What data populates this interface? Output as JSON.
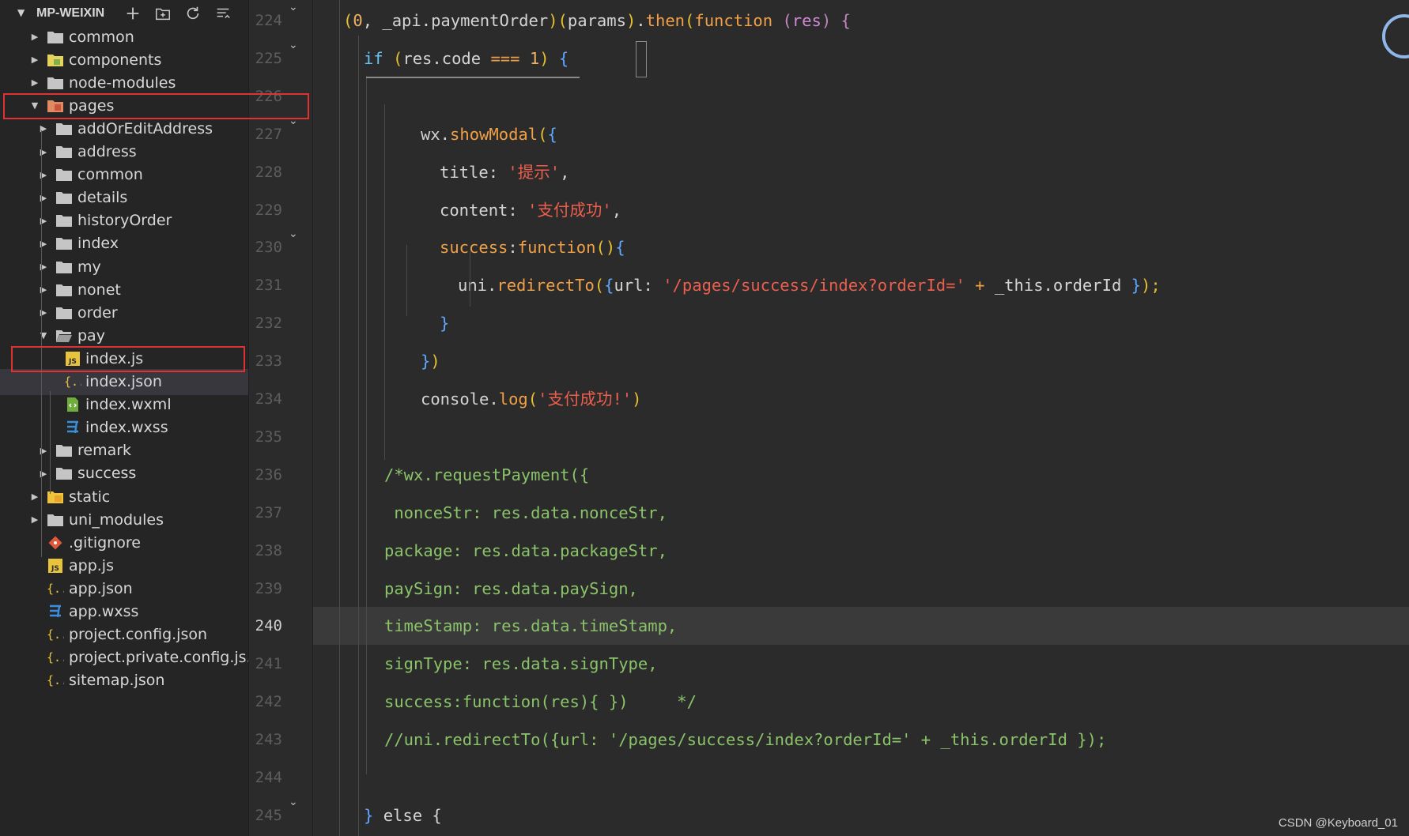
{
  "explorer": {
    "title": "MP-WEIXIN",
    "actions": [
      "new-file-icon",
      "new-folder-icon",
      "refresh-icon",
      "collapse-all-icon"
    ],
    "items": [
      {
        "label": "common",
        "kind": "folder",
        "state": "collapsed",
        "depth": 0
      },
      {
        "label": "components",
        "kind": "folder-components",
        "state": "collapsed",
        "depth": 0
      },
      {
        "label": "node-modules",
        "kind": "folder",
        "state": "collapsed",
        "depth": 0
      },
      {
        "label": "pages",
        "kind": "folder-pages",
        "state": "expanded",
        "depth": 0,
        "highlighted": true
      },
      {
        "label": "addOrEditAddress",
        "kind": "folder",
        "state": "collapsed",
        "depth": 1
      },
      {
        "label": "address",
        "kind": "folder",
        "state": "collapsed",
        "depth": 1
      },
      {
        "label": "common",
        "kind": "folder",
        "state": "collapsed",
        "depth": 1
      },
      {
        "label": "details",
        "kind": "folder",
        "state": "collapsed",
        "depth": 1
      },
      {
        "label": "historyOrder",
        "kind": "folder",
        "state": "collapsed",
        "depth": 1
      },
      {
        "label": "index",
        "kind": "folder",
        "state": "collapsed",
        "depth": 1
      },
      {
        "label": "my",
        "kind": "folder",
        "state": "collapsed",
        "depth": 1
      },
      {
        "label": "nonet",
        "kind": "folder",
        "state": "collapsed",
        "depth": 1
      },
      {
        "label": "order",
        "kind": "folder",
        "state": "collapsed",
        "depth": 1
      },
      {
        "label": "pay",
        "kind": "folder-open",
        "state": "expanded",
        "depth": 1
      },
      {
        "label": "index.js",
        "kind": "js",
        "depth": 2,
        "highlighted": true
      },
      {
        "label": "index.json",
        "kind": "json",
        "depth": 2,
        "selected": true
      },
      {
        "label": "index.wxml",
        "kind": "wxml",
        "depth": 2
      },
      {
        "label": "index.wxss",
        "kind": "css",
        "depth": 2
      },
      {
        "label": "remark",
        "kind": "folder",
        "state": "collapsed",
        "depth": 1
      },
      {
        "label": "success",
        "kind": "folder",
        "state": "collapsed",
        "depth": 1
      },
      {
        "label": "static",
        "kind": "folder-static",
        "state": "collapsed",
        "depth": 0
      },
      {
        "label": "uni_modules",
        "kind": "folder",
        "state": "collapsed",
        "depth": 0
      },
      {
        "label": ".gitignore",
        "kind": "git",
        "depth": 0
      },
      {
        "label": "app.js",
        "kind": "js",
        "depth": 0
      },
      {
        "label": "app.json",
        "kind": "json",
        "depth": 0
      },
      {
        "label": "app.wxss",
        "kind": "css",
        "depth": 0
      },
      {
        "label": "project.config.json",
        "kind": "json",
        "depth": 0
      },
      {
        "label": "project.private.config.js...",
        "kind": "json",
        "depth": 0
      },
      {
        "label": "sitemap.json",
        "kind": "json",
        "depth": 0
      }
    ]
  },
  "editor": {
    "active_line": "240",
    "line_numbers": [
      "224",
      "225",
      "226",
      "227",
      "228",
      "229",
      "230",
      "231",
      "232",
      "233",
      "234",
      "235",
      "236",
      "237",
      "238",
      "239",
      "240",
      "241",
      "242",
      "243",
      "244",
      "245"
    ],
    "fold_lines": [
      "224",
      "225",
      "227",
      "230",
      "245"
    ],
    "lines": [
      {
        "indent": 0,
        "tokens": [
          [
            "(",
            "t-paren"
          ],
          [
            "0",
            "t-num"
          ],
          [
            ", _api.",
            "t-default"
          ],
          [
            "paymentOrder",
            "t-default"
          ],
          [
            ")(",
            "t-paren"
          ],
          [
            "params",
            "t-default"
          ],
          [
            ")",
            "t-paren"
          ],
          [
            ".",
            "t-default"
          ],
          [
            "then",
            "t-func"
          ],
          [
            "(",
            "t-paren"
          ],
          [
            "function",
            "t-func"
          ],
          [
            " (",
            "t-brace"
          ],
          [
            "res",
            "t-param"
          ],
          [
            ") {",
            "t-brace"
          ]
        ]
      },
      {
        "indent": 1,
        "tokens": [
          [
            "if ",
            "t-keyword"
          ],
          [
            "(",
            "t-paren"
          ],
          [
            "res.code ",
            "t-default"
          ],
          [
            "=== ",
            "t-func"
          ],
          [
            "1",
            "t-num"
          ],
          [
            ") ",
            "t-paren"
          ],
          [
            "{",
            "t-blue"
          ]
        ]
      },
      {
        "indent": 0,
        "tokens": []
      },
      {
        "indent": 4,
        "tokens": [
          [
            "wx.",
            "t-default"
          ],
          [
            "showModal",
            "t-func"
          ],
          [
            "(",
            "t-paren"
          ],
          [
            "{",
            "t-blue"
          ]
        ]
      },
      {
        "indent": 5,
        "tokens": [
          [
            "title: ",
            "t-default"
          ],
          [
            "'提示'",
            "t-string"
          ],
          [
            ",",
            "t-default"
          ]
        ]
      },
      {
        "indent": 5,
        "tokens": [
          [
            "content: ",
            "t-default"
          ],
          [
            "'支付成功'",
            "t-string"
          ],
          [
            ",",
            "t-default"
          ]
        ]
      },
      {
        "indent": 5,
        "tokens": [
          [
            "success",
            "t-func"
          ],
          [
            ":",
            "t-default"
          ],
          [
            "function",
            "t-func"
          ],
          [
            "()",
            "t-paren"
          ],
          [
            "{",
            "t-blue"
          ]
        ]
      },
      {
        "indent": 6,
        "tokens": [
          [
            "uni.",
            "t-default"
          ],
          [
            "redirectTo",
            "t-func"
          ],
          [
            "(",
            "t-paren"
          ],
          [
            "{",
            "t-blue"
          ],
          [
            "url: ",
            "t-default"
          ],
          [
            "'/pages/success/index?orderId='",
            "t-string"
          ],
          [
            " + ",
            "t-func"
          ],
          [
            "_this.orderId ",
            "t-default"
          ],
          [
            "}",
            "t-blue"
          ],
          [
            ");",
            "t-paren"
          ]
        ]
      },
      {
        "indent": 5,
        "tokens": [
          [
            "}",
            "t-blue"
          ]
        ]
      },
      {
        "indent": 4,
        "tokens": [
          [
            "}",
            "t-blue"
          ],
          [
            ")",
            "t-paren"
          ]
        ]
      },
      {
        "indent": 4,
        "tokens": [
          [
            "console.",
            "t-default"
          ],
          [
            "log",
            "t-func"
          ],
          [
            "(",
            "t-paren"
          ],
          [
            "'支付成功!'",
            "t-string"
          ],
          [
            ")",
            "t-paren"
          ]
        ]
      },
      {
        "indent": 0,
        "tokens": []
      },
      {
        "indent": 2,
        "tokens": [
          [
            "/*wx.requestPayment({",
            "t-comment"
          ]
        ]
      },
      {
        "indent": 2,
        "tokens": [
          [
            " nonceStr: res.data.nonceStr,",
            "t-comment"
          ]
        ]
      },
      {
        "indent": 2,
        "tokens": [
          [
            "package: res.data.packageStr,",
            "t-comment"
          ]
        ]
      },
      {
        "indent": 2,
        "tokens": [
          [
            "paySign: res.data.paySign,",
            "t-comment"
          ]
        ]
      },
      {
        "indent": 2,
        "tokens": [
          [
            "timeStamp: res.data.timeStamp,",
            "t-comment"
          ]
        ]
      },
      {
        "indent": 2,
        "tokens": [
          [
            "signType: res.data.signType,",
            "t-comment"
          ]
        ]
      },
      {
        "indent": 2,
        "tokens": [
          [
            "success:function(res){ })     */",
            "t-comment"
          ]
        ]
      },
      {
        "indent": 2,
        "tokens": [
          [
            "//uni.redirectTo({url: '/pages/success/index?orderId=' + _this.orderId });",
            "t-comment"
          ]
        ]
      },
      {
        "indent": 0,
        "tokens": []
      },
      {
        "indent": 1,
        "tokens": [
          [
            "} ",
            "t-blue"
          ],
          [
            "else ",
            "t-default"
          ],
          [
            "{",
            "t-default"
          ]
        ]
      }
    ]
  },
  "watermark": "CSDN @Keyboard_01"
}
